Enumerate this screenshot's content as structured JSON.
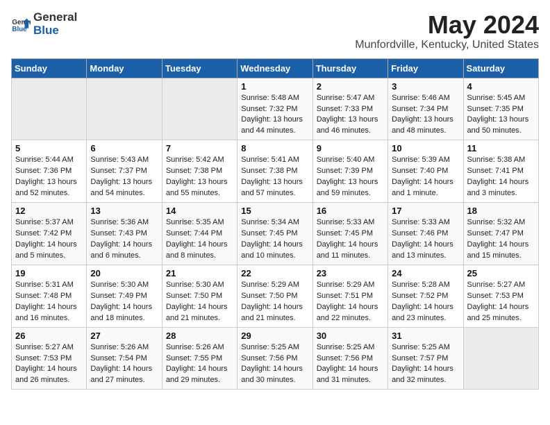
{
  "logo": {
    "general": "General",
    "blue": "Blue"
  },
  "title": "May 2024",
  "subtitle": "Munfordville, Kentucky, United States",
  "days_of_week": [
    "Sunday",
    "Monday",
    "Tuesday",
    "Wednesday",
    "Thursday",
    "Friday",
    "Saturday"
  ],
  "weeks": [
    [
      {
        "num": "",
        "info": ""
      },
      {
        "num": "",
        "info": ""
      },
      {
        "num": "",
        "info": ""
      },
      {
        "num": "1",
        "info": "Sunrise: 5:48 AM\nSunset: 7:32 PM\nDaylight: 13 hours\nand 44 minutes."
      },
      {
        "num": "2",
        "info": "Sunrise: 5:47 AM\nSunset: 7:33 PM\nDaylight: 13 hours\nand 46 minutes."
      },
      {
        "num": "3",
        "info": "Sunrise: 5:46 AM\nSunset: 7:34 PM\nDaylight: 13 hours\nand 48 minutes."
      },
      {
        "num": "4",
        "info": "Sunrise: 5:45 AM\nSunset: 7:35 PM\nDaylight: 13 hours\nand 50 minutes."
      }
    ],
    [
      {
        "num": "5",
        "info": "Sunrise: 5:44 AM\nSunset: 7:36 PM\nDaylight: 13 hours\nand 52 minutes."
      },
      {
        "num": "6",
        "info": "Sunrise: 5:43 AM\nSunset: 7:37 PM\nDaylight: 13 hours\nand 54 minutes."
      },
      {
        "num": "7",
        "info": "Sunrise: 5:42 AM\nSunset: 7:38 PM\nDaylight: 13 hours\nand 55 minutes."
      },
      {
        "num": "8",
        "info": "Sunrise: 5:41 AM\nSunset: 7:38 PM\nDaylight: 13 hours\nand 57 minutes."
      },
      {
        "num": "9",
        "info": "Sunrise: 5:40 AM\nSunset: 7:39 PM\nDaylight: 13 hours\nand 59 minutes."
      },
      {
        "num": "10",
        "info": "Sunrise: 5:39 AM\nSunset: 7:40 PM\nDaylight: 14 hours\nand 1 minute."
      },
      {
        "num": "11",
        "info": "Sunrise: 5:38 AM\nSunset: 7:41 PM\nDaylight: 14 hours\nand 3 minutes."
      }
    ],
    [
      {
        "num": "12",
        "info": "Sunrise: 5:37 AM\nSunset: 7:42 PM\nDaylight: 14 hours\nand 5 minutes."
      },
      {
        "num": "13",
        "info": "Sunrise: 5:36 AM\nSunset: 7:43 PM\nDaylight: 14 hours\nand 6 minutes."
      },
      {
        "num": "14",
        "info": "Sunrise: 5:35 AM\nSunset: 7:44 PM\nDaylight: 14 hours\nand 8 minutes."
      },
      {
        "num": "15",
        "info": "Sunrise: 5:34 AM\nSunset: 7:45 PM\nDaylight: 14 hours\nand 10 minutes."
      },
      {
        "num": "16",
        "info": "Sunrise: 5:33 AM\nSunset: 7:45 PM\nDaylight: 14 hours\nand 11 minutes."
      },
      {
        "num": "17",
        "info": "Sunrise: 5:33 AM\nSunset: 7:46 PM\nDaylight: 14 hours\nand 13 minutes."
      },
      {
        "num": "18",
        "info": "Sunrise: 5:32 AM\nSunset: 7:47 PM\nDaylight: 14 hours\nand 15 minutes."
      }
    ],
    [
      {
        "num": "19",
        "info": "Sunrise: 5:31 AM\nSunset: 7:48 PM\nDaylight: 14 hours\nand 16 minutes."
      },
      {
        "num": "20",
        "info": "Sunrise: 5:30 AM\nSunset: 7:49 PM\nDaylight: 14 hours\nand 18 minutes."
      },
      {
        "num": "21",
        "info": "Sunrise: 5:30 AM\nSunset: 7:50 PM\nDaylight: 14 hours\nand 21 minutes."
      },
      {
        "num": "22",
        "info": "Sunrise: 5:29 AM\nSunset: 7:50 PM\nDaylight: 14 hours\nand 21 minutes."
      },
      {
        "num": "23",
        "info": "Sunrise: 5:29 AM\nSunset: 7:51 PM\nDaylight: 14 hours\nand 22 minutes."
      },
      {
        "num": "24",
        "info": "Sunrise: 5:28 AM\nSunset: 7:52 PM\nDaylight: 14 hours\nand 23 minutes."
      },
      {
        "num": "25",
        "info": "Sunrise: 5:27 AM\nSunset: 7:53 PM\nDaylight: 14 hours\nand 25 minutes."
      }
    ],
    [
      {
        "num": "26",
        "info": "Sunrise: 5:27 AM\nSunset: 7:53 PM\nDaylight: 14 hours\nand 26 minutes."
      },
      {
        "num": "27",
        "info": "Sunrise: 5:26 AM\nSunset: 7:54 PM\nDaylight: 14 hours\nand 27 minutes."
      },
      {
        "num": "28",
        "info": "Sunrise: 5:26 AM\nSunset: 7:55 PM\nDaylight: 14 hours\nand 29 minutes."
      },
      {
        "num": "29",
        "info": "Sunrise: 5:25 AM\nSunset: 7:56 PM\nDaylight: 14 hours\nand 30 minutes."
      },
      {
        "num": "30",
        "info": "Sunrise: 5:25 AM\nSunset: 7:56 PM\nDaylight: 14 hours\nand 31 minutes."
      },
      {
        "num": "31",
        "info": "Sunrise: 5:25 AM\nSunset: 7:57 PM\nDaylight: 14 hours\nand 32 minutes."
      },
      {
        "num": "",
        "info": ""
      }
    ]
  ]
}
